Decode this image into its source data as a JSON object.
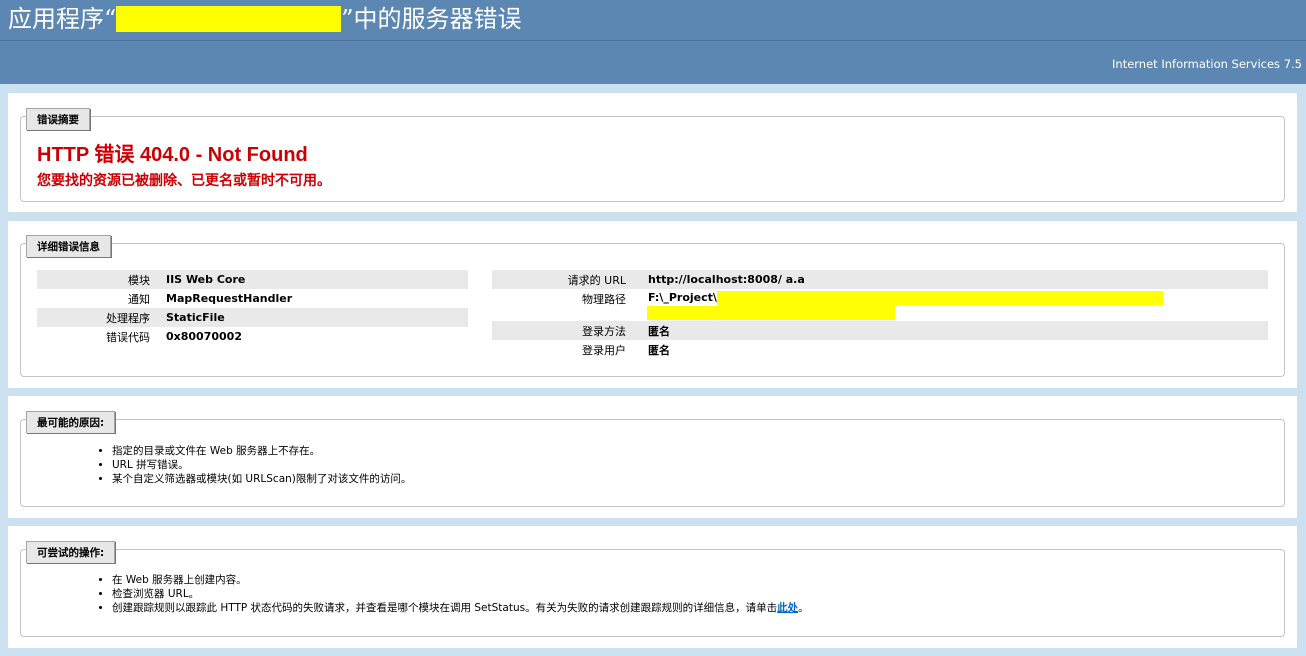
{
  "header": {
    "title_prefix": "应用程序“",
    "title_suffix": "”中的服务器错误",
    "server": "Internet Information Services 7.5"
  },
  "summary": {
    "tab": "错误摘要",
    "title": "HTTP 错误 404.0 - Not Found",
    "message": "您要找的资源已被删除、已更名或暂时不可用。"
  },
  "details": {
    "tab": "详细错误信息",
    "left": [
      {
        "label": "模块",
        "value": "IIS Web Core"
      },
      {
        "label": "通知",
        "value": "MapRequestHandler"
      },
      {
        "label": "处理程序",
        "value": "StaticFile"
      },
      {
        "label": "错误代码",
        "value": "0x80070002"
      }
    ],
    "right": [
      {
        "label": "请求的 URL",
        "value": "http://localhost:8008/ a.a"
      },
      {
        "label": "物理路径",
        "value": "F:\\_Project\\"
      },
      {
        "label": "登录方法",
        "value": "匿名"
      },
      {
        "label": "登录用户",
        "value": "匿名"
      }
    ]
  },
  "causes": {
    "tab": "最可能的原因:",
    "items": [
      "指定的目录或文件在 Web 服务器上不存在。",
      "URL 拼写错误。",
      "某个自定义筛选器或模块(如 URLScan)限制了对该文件的访问。"
    ]
  },
  "actions": {
    "tab": "可尝试的操作:",
    "items": [
      "在 Web 服务器上创建内容。",
      "检查浏览器 URL。"
    ],
    "last_item_text": "创建跟踪规则以跟踪此 HTTP 状态代码的失败请求，并查看是哪个模块在调用 SetStatus。有关为失败的请求创建跟踪规则的详细信息，请单击",
    "last_item_link": "此处",
    "last_item_end": "。"
  }
}
